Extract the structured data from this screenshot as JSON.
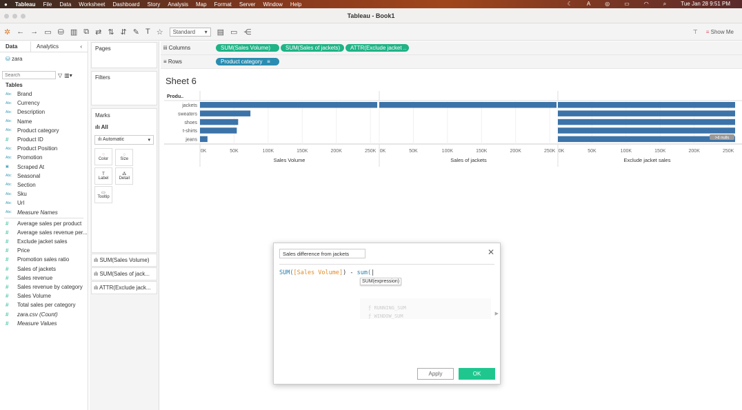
{
  "menubar": {
    "app": "Tableau",
    "items": [
      "File",
      "Data",
      "Worksheet",
      "Dashboard",
      "Story",
      "Analysis",
      "Map",
      "Format",
      "Server",
      "Window",
      "Help"
    ],
    "clock": "Tue Jan 28  9:51 PM"
  },
  "window": {
    "title": "Tableau - Book1"
  },
  "toolbar": {
    "fit": "Standard",
    "show_me": "Show Me"
  },
  "data_pane": {
    "tabs": [
      "Data",
      "Analytics"
    ],
    "datasource": "zara",
    "search_placeholder": "Search",
    "tables_label": "Tables",
    "dimensions": [
      {
        "name": "Brand",
        "type": "Abc"
      },
      {
        "name": "Currency",
        "type": "Abc"
      },
      {
        "name": "Description",
        "type": "Abc"
      },
      {
        "name": "Name",
        "type": "Abc"
      },
      {
        "name": "Product category",
        "type": "Abc"
      },
      {
        "name": "Product ID",
        "type": "#"
      },
      {
        "name": "Product Position",
        "type": "Abc"
      },
      {
        "name": "Promotion",
        "type": "Abc"
      },
      {
        "name": "Scraped At",
        "type": "date"
      },
      {
        "name": "Seasonal",
        "type": "Abc"
      },
      {
        "name": "Section",
        "type": "Abc"
      },
      {
        "name": "Sku",
        "type": "Abc"
      },
      {
        "name": "Url",
        "type": "Abc"
      },
      {
        "name": "Measure Names",
        "type": "Abc",
        "italic": true
      }
    ],
    "measures": [
      {
        "name": "Average sales per product"
      },
      {
        "name": "Average sales revenue per..."
      },
      {
        "name": "Exclude jacket sales"
      },
      {
        "name": "Price"
      },
      {
        "name": "Promotion sales ratio"
      },
      {
        "name": "Sales of jackets"
      },
      {
        "name": "Sales revenue"
      },
      {
        "name": "Sales revenue by category"
      },
      {
        "name": "Sales Volume"
      },
      {
        "name": "Total sales per category"
      },
      {
        "name": "zara.csv (Count)",
        "italic": true
      },
      {
        "name": "Measure Values",
        "italic": true
      }
    ]
  },
  "shelves": {
    "pages": "Pages",
    "filters": "Filters",
    "marks": "Marks",
    "all": "All",
    "mark_type": "Automatic",
    "mark_buttons": [
      "Color",
      "Size",
      "Label",
      "Detail",
      "Tooltip"
    ],
    "mark_fields": [
      "SUM(Sales Volume)",
      "SUM(Sales of jack...",
      "ATTR(Exclude jack..."
    ]
  },
  "columns": {
    "label": "Columns",
    "pills": [
      "SUM(Sales Volume)",
      "SUM(Sales of jackets)",
      "ATTR(Exclude jacket .."
    ]
  },
  "rows": {
    "label": "Rows",
    "pills": [
      "Product category"
    ]
  },
  "sheet": {
    "title": "Sheet 6",
    "row_header": "Produ.."
  },
  "chart_data": {
    "type": "bar",
    "orientation": "horizontal",
    "categories": [
      "jackets",
      "sweaters",
      "shoes",
      "t-shirts",
      "jeans"
    ],
    "series": [
      {
        "name": "Sales Volume",
        "values": [
          260000,
          74000,
          56000,
          54000,
          11000
        ]
      },
      {
        "name": "Sales of jackets",
        "values": [
          260000,
          null,
          null,
          null,
          null
        ]
      },
      {
        "name": "Exclude jacket sales",
        "values": [
          260000,
          260000,
          260000,
          260000,
          260000
        ]
      }
    ],
    "xlim": [
      0,
      262000
    ],
    "ticks": [
      "0K",
      "50K",
      "100K",
      "150K",
      "200K",
      "250K"
    ],
    "tick_values": [
      0,
      50000,
      100000,
      150000,
      200000,
      250000
    ],
    "null_indicator": ">4 nulls",
    "bar_color": "#3c73a8",
    "grid": true
  },
  "dialog": {
    "name": "Sales difference from jackets",
    "formula": {
      "fn1": "SUM(",
      "field": "[Sales Volume]",
      "mid": ") - ",
      "fn2": "sum("
    },
    "tooltip": "SUM(expression)",
    "suggestions": [
      "RUNNING_SUM",
      "WINDOW_SUM"
    ],
    "apply": "Apply",
    "ok": "OK"
  }
}
